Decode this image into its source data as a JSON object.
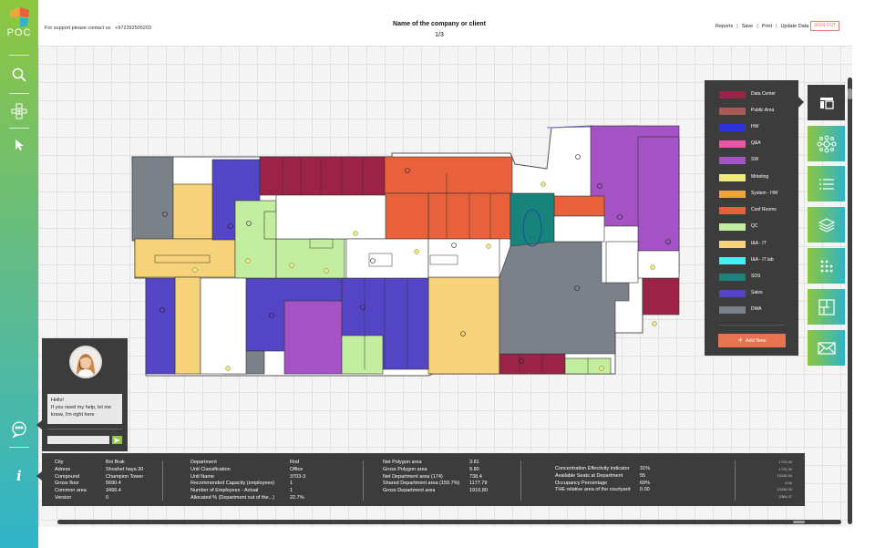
{
  "app": {
    "logo_text": "POC"
  },
  "header": {
    "support_text": "For support please contact us",
    "support_phone": "+972392505203",
    "company": "Name of the company or client",
    "page": "1/3",
    "menu": [
      "Reports",
      "Save",
      "Print",
      "Update Data"
    ],
    "signout": "SIGN OUT"
  },
  "colors": {
    "accent_green": "#8dc63f",
    "accent_teal": "#2fb4c9",
    "panel_dark": "#3c3c3c",
    "add_button": "#e8744f"
  },
  "legend": {
    "items": [
      {
        "label": "Data Center",
        "color": "#9b2348"
      },
      {
        "label": "Public Area",
        "color": "#a85a57"
      },
      {
        "label": "HW",
        "color": "#2f32d8"
      },
      {
        "label": "Q&A",
        "color": "#f24fa5"
      },
      {
        "label": "SW",
        "color": "#a452c4"
      },
      {
        "label": "Mrketing",
        "color": "#f0ea7d"
      },
      {
        "label": "System - HW",
        "color": "#f4a23a"
      },
      {
        "label": "Conf Rooms",
        "color": "#e8613b"
      },
      {
        "label": "QC",
        "color": "#c3ee9f"
      },
      {
        "label": "I&A - IT",
        "color": "#f6d37a"
      },
      {
        "label": "I&A - IT lab",
        "color": "#3ff2f2"
      },
      {
        "label": "SDS",
        "color": "#17837b"
      },
      {
        "label": "Sales",
        "color": "#5345c6"
      },
      {
        "label": "DWA",
        "color": "#7b8189"
      }
    ],
    "add_new": "Add New"
  },
  "right_tools": [
    "layout-icon",
    "network-icon",
    "list-icon",
    "layers-icon",
    "grid-dots-icon",
    "floorplan-icon",
    "mail-icon"
  ],
  "chat": {
    "line1": "Hello!",
    "line2": "If you need my help, let me know, I'm right here",
    "input_placeholder": ""
  },
  "info": {
    "col1": [
      {
        "label": "City",
        "value": "Bni Brak"
      },
      {
        "label": "Adress",
        "value": "Shoshet haya 30"
      },
      {
        "label": "Compound",
        "value": "Champion Tower"
      },
      {
        "label": "Gross floor",
        "value": "5690.4"
      },
      {
        "label": "Common area",
        "value": "3499.4"
      },
      {
        "label": "Version",
        "value": "0"
      }
    ],
    "col2": [
      {
        "label": "Department",
        "value": "Rnd"
      },
      {
        "label": "Unit Classification",
        "value": "Office"
      },
      {
        "label": "Unit Name",
        "value": "3703-3"
      },
      {
        "label": "Recommended Capacity (employees)",
        "value": "1"
      },
      {
        "label": "Number of Employees - Actual",
        "value": "1"
      },
      {
        "label": "Allocated % (Department out of the...)",
        "value": "22.7%"
      }
    ],
    "col3": [
      {
        "label": "Net Polygon area",
        "value": "3.81"
      },
      {
        "label": "Gross Polygon area",
        "value": "9.80"
      },
      {
        "label": "Net Department area (174)",
        "value": "738.4"
      },
      {
        "label": "Shared Department area (159.7%)",
        "value": "1177.79"
      },
      {
        "label": "Gross Department area",
        "value": "1916.80"
      }
    ],
    "col4": [
      {
        "label": "Concentration Effectivity indicator",
        "value": "31%"
      },
      {
        "label": "Available Seats at Department",
        "value": "55"
      },
      {
        "label": "Occupancy Percentage",
        "value": "69%"
      },
      {
        "label": "THE relative area of the courtyard",
        "value": "0.00"
      }
    ],
    "mini": [
      "1726.30",
      "1726.30",
      "13338.34",
      "0.00",
      "13338.34",
      "3364.37"
    ]
  }
}
